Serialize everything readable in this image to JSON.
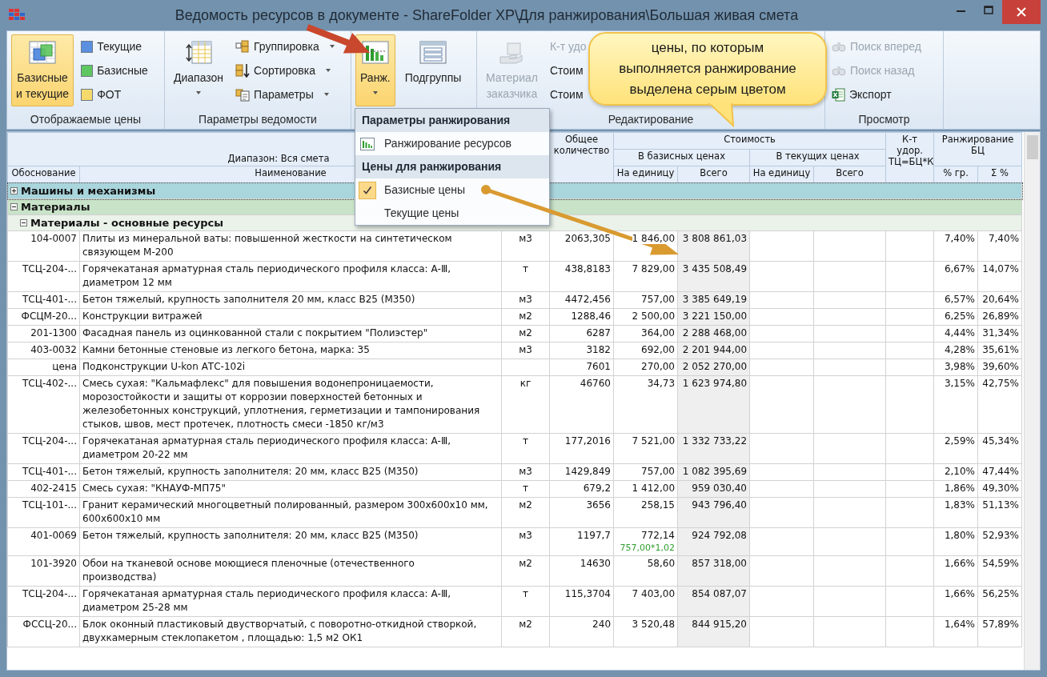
{
  "window": {
    "title": "Ведомость ресурсов в документе - ShareFolder XP\\Для ранжирования\\Большая живая смета"
  },
  "ribbon": {
    "groups": [
      {
        "label": "Отображаемые цены",
        "items": [
          {
            "kind": "large",
            "label": "Базисные\nи текущие",
            "selected": true,
            "disabled": false
          },
          {
            "kind": "small",
            "label": "Текущие",
            "color": "#5b8fe0",
            "selected": false,
            "disabled": false
          },
          {
            "kind": "small",
            "label": "Базисные",
            "color": "#5fc75f",
            "selected": false,
            "disabled": false
          },
          {
            "kind": "small",
            "label": "ФОТ",
            "color": "#f5d96b",
            "selected": false,
            "disabled": false
          }
        ]
      },
      {
        "label": "Параметры ведомости",
        "items": [
          {
            "kind": "large",
            "label": "Диапазон",
            "dropdown": true,
            "selected": false,
            "disabled": false
          },
          {
            "kind": "small",
            "label": "Группировка",
            "dropdown": true,
            "selected": false,
            "disabled": false
          },
          {
            "kind": "small",
            "label": "Сортировка",
            "dropdown": true,
            "selected": false,
            "disabled": false
          },
          {
            "kind": "small",
            "label": "Параметры",
            "dropdown": true,
            "selected": false,
            "disabled": false
          }
        ]
      },
      {
        "items": [
          {
            "kind": "large",
            "label": "Ранж.",
            "dropdown": true,
            "selected": true,
            "disabled": false
          },
          {
            "kind": "large",
            "label": "Подгруппы",
            "selected": false,
            "disabled": false
          }
        ]
      },
      {
        "label": "Редактирование",
        "items": [
          {
            "kind": "large",
            "label": "Материал\nзаказчика",
            "selected": false,
            "disabled": true
          },
          {
            "kind": "small",
            "label": "К-т удо",
            "selected": false,
            "disabled": true
          },
          {
            "kind": "small",
            "label": "Стоим",
            "selected": false,
            "disabled": false
          },
          {
            "kind": "small",
            "label": "Стоим",
            "selected": false,
            "disabled": false
          }
        ]
      },
      {
        "label": "Просмотр",
        "items": [
          {
            "kind": "small",
            "label": "Поиск вперед",
            "selected": false,
            "disabled": true
          },
          {
            "kind": "small",
            "label": "Поиск назад",
            "selected": false,
            "disabled": true
          },
          {
            "kind": "small",
            "label": "Экспорт",
            "selected": false,
            "disabled": false
          }
        ]
      }
    ]
  },
  "ranking_menu": {
    "sections": [
      {
        "header": "Параметры ранжирования",
        "items": [
          {
            "kind": "command",
            "label": "Ранжирование ресурсов"
          }
        ]
      },
      {
        "header": "Цены для ранжирования",
        "items": [
          {
            "kind": "option",
            "label": "Базисные цены",
            "checked": true
          },
          {
            "kind": "option",
            "label": "Текущие цены",
            "checked": false
          }
        ]
      }
    ]
  },
  "callout": {
    "lines": [
      "цены, по которым",
      "выполняется ранжирование",
      "выделена серым цветом"
    ]
  },
  "table": {
    "header": {
      "range": "Диапазон: Вся смета",
      "basis": "Обоснование",
      "name": "Наименование",
      "quantity": "Общее количество",
      "cost": "Стоимость",
      "base_prices": "В базисных ценах",
      "current_prices": "В текущих ценах",
      "unit_price_base": "На единицу",
      "total_base": "Всего",
      "unit_price_current": "На единицу",
      "total_current": "Всего",
      "coefficient": "К-т удор. ТЦ=БЦ*К",
      "ranking": "Ранжирование БЦ",
      "pct_group": "% гр.",
      "pct_sum": "Σ %"
    },
    "groups": [
      {
        "label": "Машины и механизмы",
        "expanded": false,
        "selected": true
      },
      {
        "label": "Материалы",
        "expanded": true,
        "selected": false,
        "groups": [
          {
            "label": "Материалы - основные ресурсы",
            "expanded": true,
            "selected": false,
            "rows": [
              {
                "code": "104-0007",
                "name": "Плиты из минеральной ваты: повышенной жесткости на синтетическом\nсвязующем М-200",
                "unit": "м3",
                "quantity": "2063,305",
                "unit_price": "1 846,00",
                "total": "3 808 861,03",
                "pct_group": "7,40%",
                "pct_sum": "7,40%"
              },
              {
                "code": "ТСЦ-204-...",
                "name": "Горячекатаная арматурная сталь периодического профиля класса: А-Ⅲ,\nдиаметром 12 мм",
                "unit": "т",
                "quantity": "438,8183",
                "unit_price": "7 829,00",
                "total": "3 435 508,49",
                "pct_group": "6,67%",
                "pct_sum": "14,07%"
              },
              {
                "code": "ТСЦ-401-...",
                "name": "Бетон тяжелый, крупность заполнителя 20 мм, класс В25 (М350)",
                "unit": "м3",
                "quantity": "4472,456",
                "unit_price": "757,00",
                "total": "3 385 649,19",
                "pct_group": "6,57%",
                "pct_sum": "20,64%"
              },
              {
                "code": "ФСЦМ-20...",
                "name": "Конструкции витражей",
                "unit": "м2",
                "quantity": "1288,46",
                "unit_price": "2 500,00",
                "total": "3 221 150,00",
                "pct_group": "6,25%",
                "pct_sum": "26,89%"
              },
              {
                "code": "201-1300",
                "name": "Фасадная панель из оцинкованной стали с покрытием \"Полиэстер\"",
                "unit": "м2",
                "quantity": "6287",
                "unit_price": "364,00",
                "total": "2 288 468,00",
                "pct_group": "4,44%",
                "pct_sum": "31,34%"
              },
              {
                "code": "403-0032",
                "name": "Камни бетонные стеновые из легкого бетона, марка: 35",
                "unit": "м3",
                "quantity": "3182",
                "unit_price": "692,00",
                "total": "2 201 944,00",
                "pct_group": "4,28%",
                "pct_sum": "35,61%"
              },
              {
                "code": "цена",
                "name": "Подконструкции U-kon АТС-102i",
                "quantity": "7601",
                "unit_price": "270,00",
                "total": "2 052 270,00",
                "pct_group": "3,98%",
                "pct_sum": "39,60%"
              },
              {
                "code": "ТСЦ-402-...",
                "name": "Смесь сухая: \"Кальмафлекс\" для повышения водонепроницаемости,\nморозостойкости и защиты от коррозии поверхностей бетонных и\nжелезобетонных конструкций, уплотнения, герметизации и тампонирования\nстыков, швов, мест протечек, плотность смеси -1850 кг/м3",
                "unit": "кг",
                "quantity": "46760",
                "unit_price": "34,73",
                "total": "1 623 974,80",
                "pct_group": "3,15%",
                "pct_sum": "42,75%"
              },
              {
                "code": "ТСЦ-204-...",
                "name": "Горячекатаная арматурная сталь периодического профиля класса: А-Ⅲ,\nдиаметром 20-22 мм",
                "unit": "т",
                "quantity": "177,2016",
                "unit_price": "7 521,00",
                "total": "1 332 733,22",
                "pct_group": "2,59%",
                "pct_sum": "45,34%"
              },
              {
                "code": "ТСЦ-401-...",
                "name": "Бетон тяжелый, крупность заполнителя: 20 мм, класс В25 (М350)",
                "unit": "м3",
                "quantity": "1429,849",
                "unit_price": "757,00",
                "total": "1 082 395,69",
                "pct_group": "2,10%",
                "pct_sum": "47,44%"
              },
              {
                "code": "402-2415",
                "name": "Смесь сухая: \"КНАУФ-МП75\"",
                "unit": "т",
                "quantity": "679,2",
                "unit_price": "1 412,00",
                "total": "959 030,40",
                "pct_group": "1,86%",
                "pct_sum": "49,30%"
              },
              {
                "code": "ТСЦ-101-...",
                "name": "Гранит керамический многоцветный полированный, размером 300х600х10 мм,\n600х600х10 мм",
                "unit": "м2",
                "quantity": "3656",
                "unit_price": "258,15",
                "total": "943 796,40",
                "pct_group": "1,83%",
                "pct_sum": "51,13%"
              },
              {
                "code": "401-0069",
                "name": "Бетон тяжелый, крупность заполнителя: 20 мм, класс В25 (М350)",
                "unit": "м3",
                "quantity": "1197,7",
                "unit_price": "772,14",
                "price_note": "757,00*1,02",
                "total": "924 792,08",
                "pct_group": "1,80%",
                "pct_sum": "52,93%"
              },
              {
                "code": "101-3920",
                "name": "Обои на тканевой основе моющиеся пленочные (отечественного\nпроизводства)",
                "unit": "м2",
                "quantity": "14630",
                "unit_price": "58,60",
                "total": "857 318,00",
                "pct_group": "1,66%",
                "pct_sum": "54,59%"
              },
              {
                "code": "ТСЦ-204-...",
                "name": "Горячекатаная арматурная сталь периодического профиля класса: А-Ⅲ,\nдиаметром 25-28 мм",
                "unit": "т",
                "quantity": "115,3704",
                "unit_price": "7 403,00",
                "total": "854 087,07",
                "pct_group": "1,66%",
                "pct_sum": "56,25%"
              },
              {
                "code": "ФССЦ-20...",
                "name": "Блок оконный пластиковый двустворчатый, с поворотно-откидной створкой,\nдвухкамерным стеклопакетом , площадью:  1,5 м2 ОК1",
                "unit": "м2",
                "quantity": "240",
                "unit_price": "3 520,48",
                "total": "844 915,20",
                "pct_group": "1,64%",
                "pct_sum": "57,89%"
              }
            ]
          }
        ]
      }
    ]
  }
}
